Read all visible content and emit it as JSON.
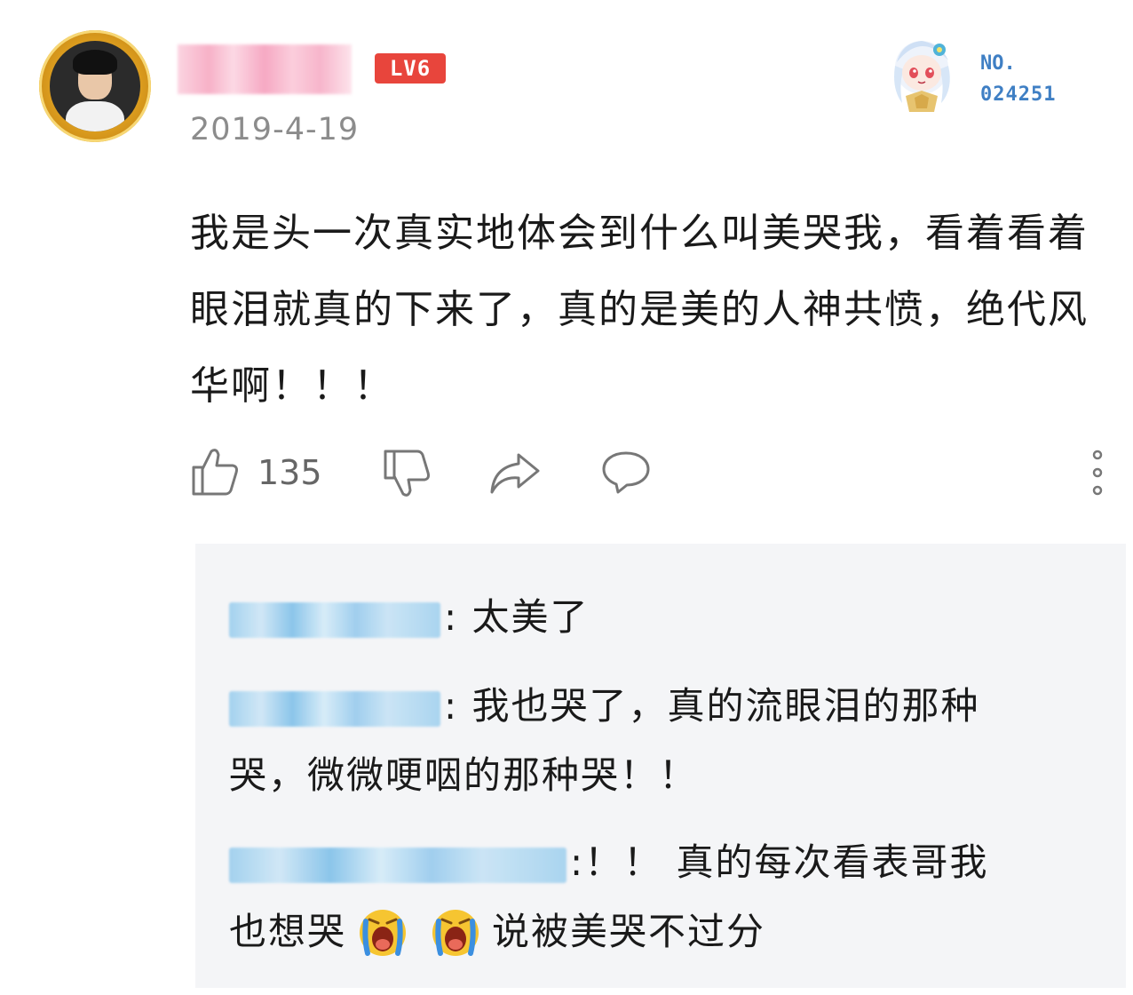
{
  "comment": {
    "level_badge": "LV6",
    "date": "2019-4-19",
    "text": "我是头一次真实地体会到什么叫美哭我，看着看着眼泪就真的下来了，真的是美的人神共愤，绝代风华啊！！！",
    "likes": "135",
    "fan_card": {
      "no_label": "NO.",
      "no_value": "024251"
    }
  },
  "icons": {
    "like": "thumbs-up-icon",
    "dislike": "thumbs-down-icon",
    "share": "share-icon",
    "reply": "comment-bubble-icon",
    "more": "more-vertical-icon",
    "cry": "crying-emoji-icon"
  },
  "replies": [
    {
      "text": ": 太美了"
    },
    {
      "text": ": 我也哭了，真的流眼泪的那种",
      "text_cont": "哭，微微哽咽的那种哭！！"
    },
    {
      "text": ":！！ 真的每次看表哥我",
      "text_cont_a": "也想哭",
      "text_cont_b": "说被美哭不过分"
    }
  ],
  "colors": {
    "badge": "#e8453c",
    "fan_number": "#3f7fc4",
    "date": "#8c8c8c",
    "reply_bg": "#f4f5f7"
  }
}
